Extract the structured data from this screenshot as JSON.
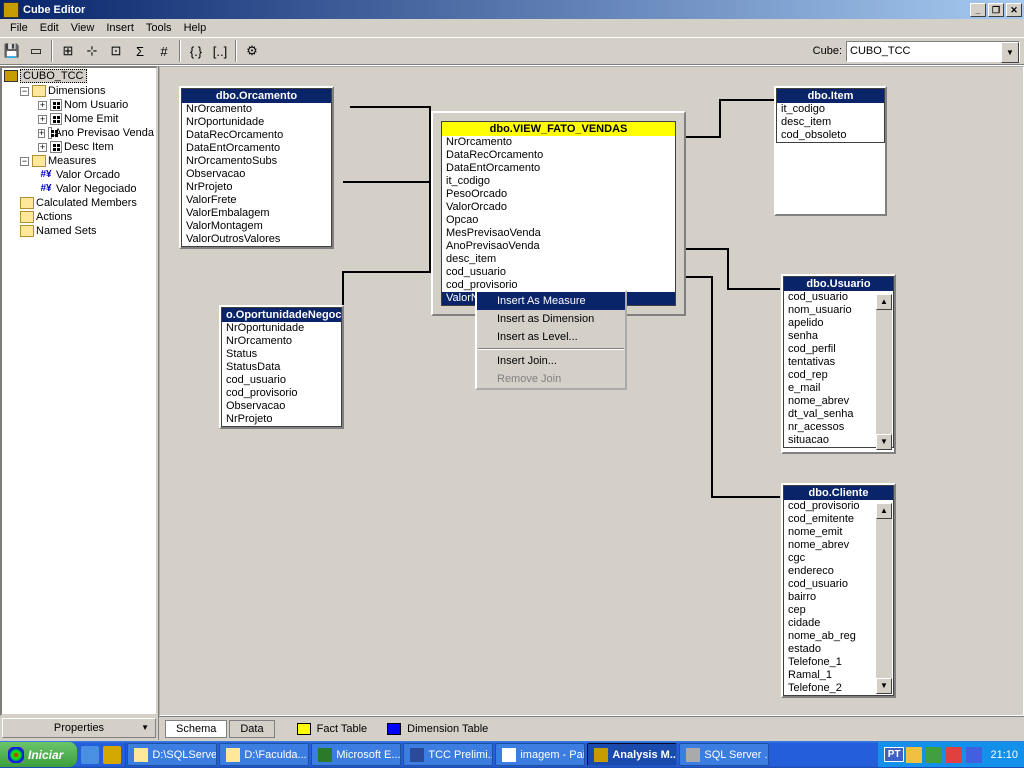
{
  "window": {
    "title": "Cube Editor"
  },
  "menu": {
    "file": "File",
    "edit": "Edit",
    "view": "View",
    "insert": "Insert",
    "tools": "Tools",
    "help": "Help"
  },
  "toolbar": {
    "cube_label": "Cube:",
    "cube_value": "CUBO_TCC"
  },
  "tree": {
    "root": "CUBO_TCC",
    "dimensions": {
      "label": "Dimensions",
      "items": [
        "Nom Usuario",
        "Nome Emit",
        "Ano Previsao Venda",
        "Desc Item"
      ]
    },
    "measures": {
      "label": "Measures",
      "items": [
        "Valor Orcado",
        "Valor Negociado"
      ]
    },
    "calc": "Calculated Members",
    "actions": "Actions",
    "named": "Named Sets"
  },
  "properties_btn": "Properties",
  "tables": {
    "orcamento": {
      "title": "dbo.Orcamento",
      "cols": [
        "NrOrcamento",
        "NrOportunidade",
        "DataRecOrcamento",
        "DataEntOrcamento",
        "NrOrcamentoSubs",
        "Observacao",
        "NrProjeto",
        "ValorFrete",
        "ValorEmbalagem",
        "ValorMontagem",
        "ValorOutrosValores"
      ]
    },
    "oport": {
      "title": "o.OportunidadeNegoc",
      "cols": [
        "NrOportunidade",
        "NrOrcamento",
        "Status",
        "StatusData",
        "cod_usuario",
        "cod_provisorio",
        "Observacao",
        "NrProjeto"
      ]
    },
    "fato": {
      "title": "dbo.VIEW_FATO_VENDAS",
      "cols": [
        "NrOrcamento",
        "DataRecOrcamento",
        "DataEntOrcamento",
        "it_codigo",
        "PesoOrcado",
        "ValorOrcado",
        "Opcao",
        "MesPrevisaoVenda",
        "AnoPrevisaoVenda",
        "desc_item",
        "cod_usuario",
        "cod_provisorio",
        "ValorNegociado"
      ]
    },
    "item": {
      "title": "dbo.Item",
      "cols": [
        "it_codigo",
        "desc_item",
        "cod_obsoleto"
      ]
    },
    "usuario": {
      "title": "dbo.Usuario",
      "cols": [
        "cod_usuario",
        "nom_usuario",
        "apelido",
        "senha",
        "cod_perfil",
        "tentativas",
        "cod_rep",
        "e_mail",
        "nome_abrev",
        "dt_val_senha",
        "nr_acessos",
        "situacao"
      ]
    },
    "cliente": {
      "title": "dbo.Cliente",
      "cols": [
        "cod_provisorio",
        "cod_emitente",
        "nome_emit",
        "nome_abrev",
        "cgc",
        "endereco",
        "cod_usuario",
        "bairro",
        "cep",
        "cidade",
        "nome_ab_reg",
        "estado",
        "Telefone_1",
        "Ramal_1",
        "Telefone_2"
      ]
    }
  },
  "context_menu": {
    "insert_measure": "Insert As Measure",
    "insert_dim": "Insert as Dimension",
    "insert_level": "Insert as Level...",
    "insert_join": "Insert Join...",
    "remove_join": "Remove Join"
  },
  "bottom_tabs": {
    "schema": "Schema",
    "data": "Data",
    "fact": "Fact Table",
    "dim": "Dimension Table"
  },
  "taskbar": {
    "start": "Iniciar",
    "tasks": [
      "D:\\SQLServer",
      "D:\\Faculda...",
      "Microsoft E...",
      "TCC Prelimi...",
      "imagem - Paint",
      "Analysis M...",
      "SQL Server ..."
    ],
    "lang": "PT",
    "clock": "21:10"
  }
}
